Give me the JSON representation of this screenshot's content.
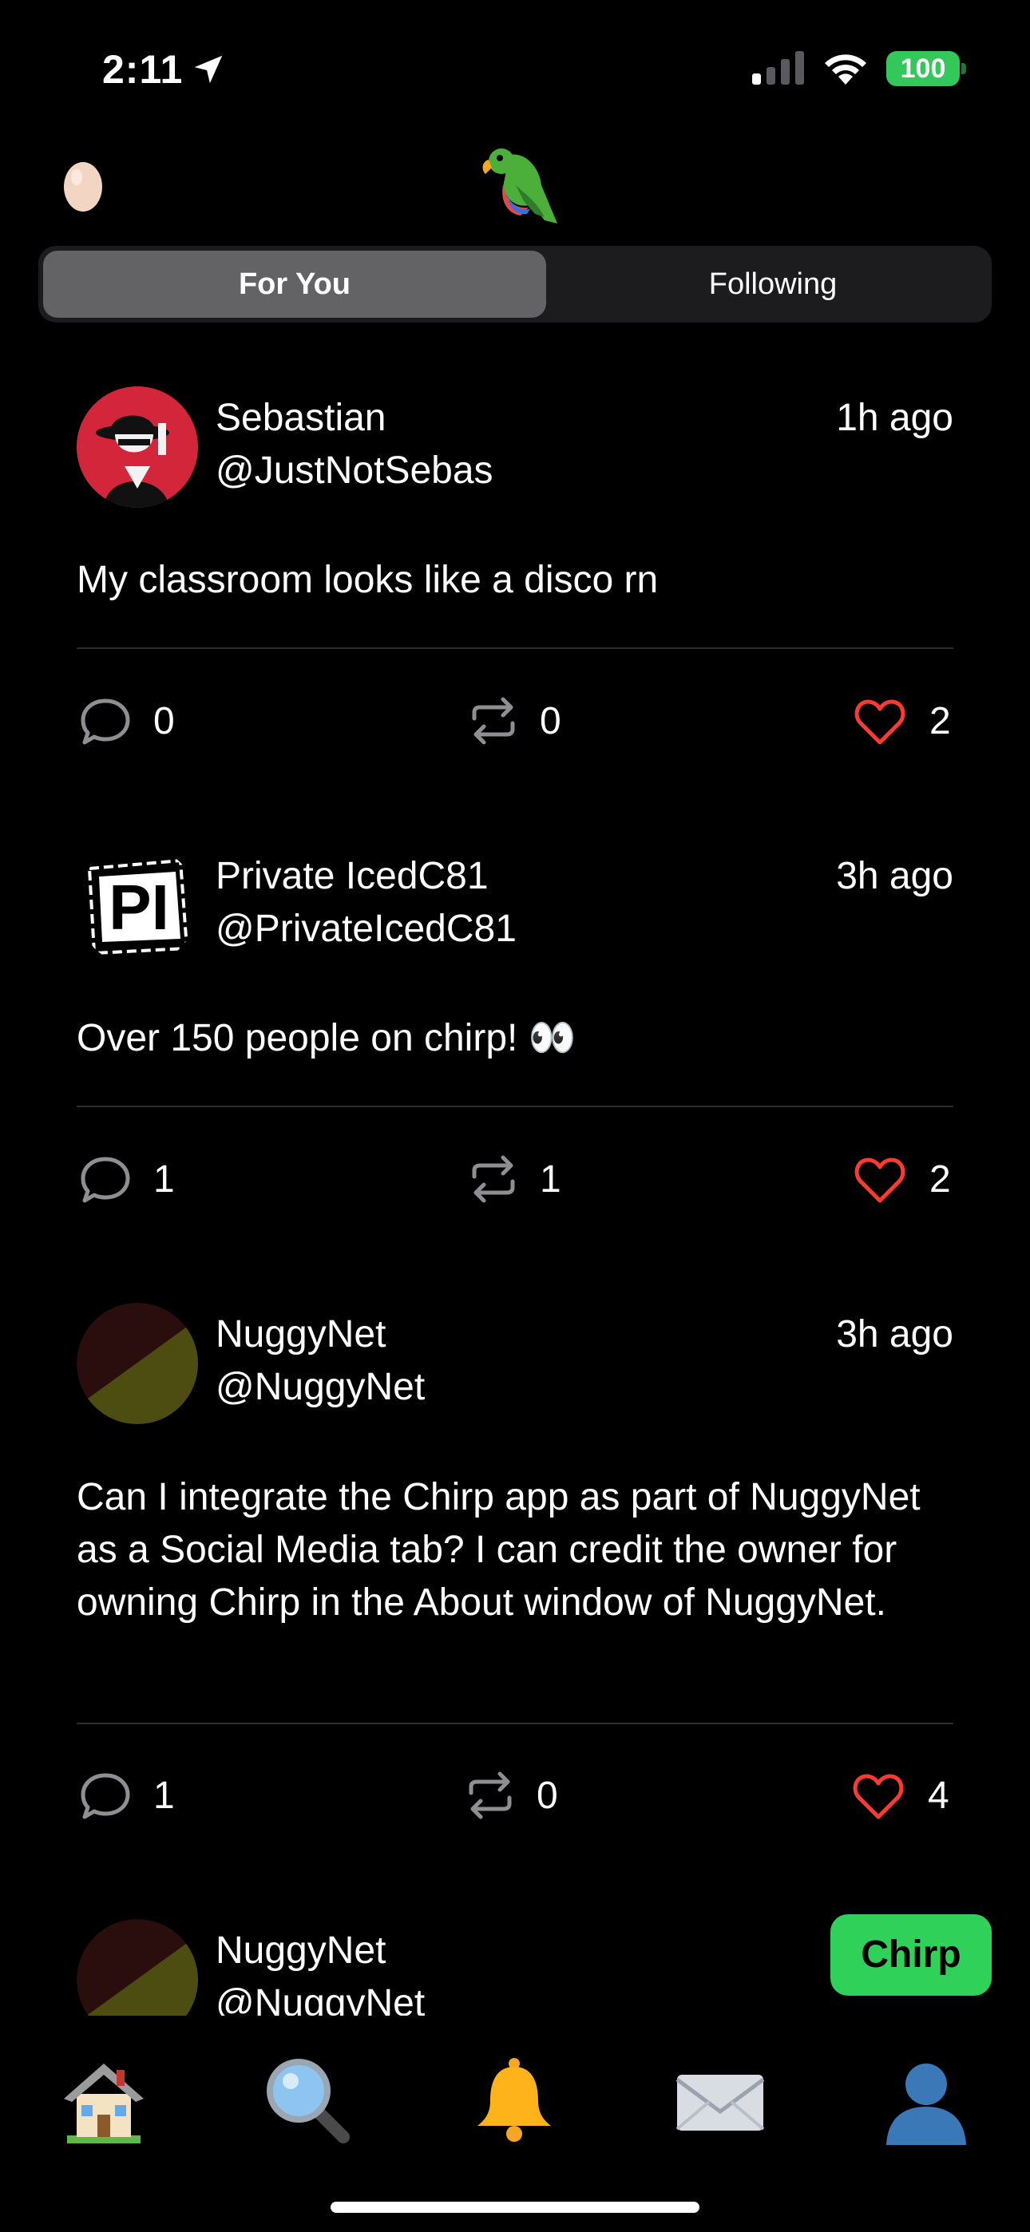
{
  "status_bar": {
    "time": "2:11",
    "battery": "100"
  },
  "header": {
    "left_icon": "egg-icon",
    "center_icon": "parrot-logo-icon"
  },
  "tabs": {
    "for_you": "For You",
    "following": "Following",
    "active": "For You"
  },
  "posts": [
    {
      "name": "Sebastian",
      "handle": "@JustNotSebas",
      "time": "1h ago",
      "text": "My classroom looks like a disco rn",
      "replies": "0",
      "rechirps": "0",
      "likes": "2"
    },
    {
      "name": "Private IcedC81",
      "handle": "@PrivateIcedC81",
      "time": "3h ago",
      "text": "Over 150 people on chirp! 👀",
      "replies": "1",
      "rechirps": "1",
      "likes": "2"
    },
    {
      "name": "NuggyNet",
      "handle": "@NuggyNet",
      "time": "3h ago",
      "text": "Can I integrate the Chirp app as part of NuggyNet as a Social Media tab? I can credit the owner for owning Chirp in the About window of NuggyNet.",
      "replies": "1",
      "rechirps": "0",
      "likes": "4"
    },
    {
      "name": "NuggyNet",
      "handle": "@NuggyNet"
    }
  ],
  "compose_button": "Chirp",
  "tab_bar": [
    "home-icon",
    "search-icon",
    "notifications-bell-icon",
    "messages-envelope-icon",
    "profile-icon"
  ],
  "colors": {
    "like": "#ff3b30",
    "compose": "#30d158",
    "battery": "#34c759",
    "segment_active": "#636366",
    "segment_bg": "#1c1c1e"
  }
}
